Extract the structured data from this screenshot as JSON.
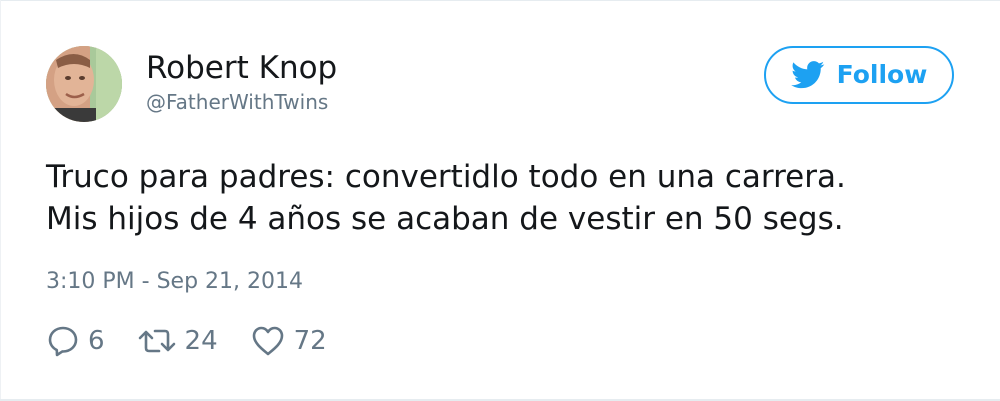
{
  "user": {
    "name": "Robert Knop",
    "handle": "@FatherWithTwins"
  },
  "follow_button": {
    "label": "Follow",
    "icon": "twitter-bird-icon"
  },
  "tweet": {
    "lines": [
      "Truco para padres: convertidlo todo en una carrera.",
      "Mis hijos de 4 años se acaban de vestir en 50 segs."
    ],
    "timestamp": "3:10 PM - Sep 21, 2014"
  },
  "actions": {
    "replies": {
      "icon": "reply-icon",
      "count": "6"
    },
    "retweets": {
      "icon": "retweet-icon",
      "count": "24"
    },
    "likes": {
      "icon": "heart-icon",
      "count": "72"
    }
  },
  "colors": {
    "accent": "#1da1f2",
    "text_primary": "#14171a",
    "text_secondary": "#657786"
  }
}
